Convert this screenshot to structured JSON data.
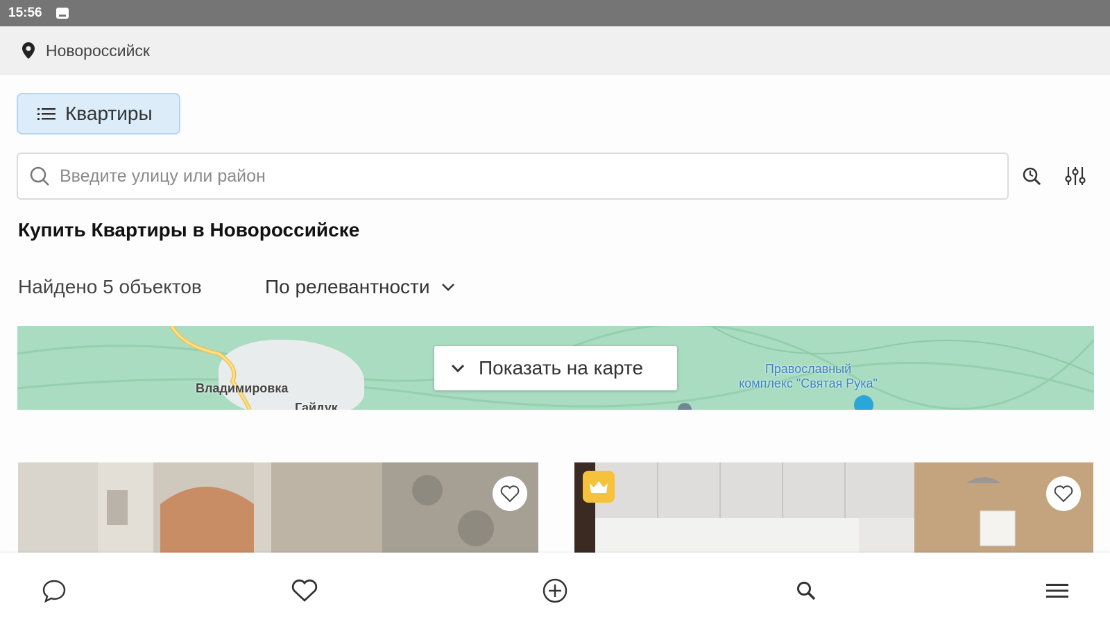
{
  "status_bar": {
    "time": "15:56"
  },
  "location": {
    "city": "Новороссийск"
  },
  "category_chip": {
    "label": "Квартиры"
  },
  "search": {
    "placeholder": "Введите улицу или район"
  },
  "page_heading": "Купить Квартиры в Новороссийске",
  "results": {
    "found_text": "Найдено 5 объектов",
    "sort_label": "По релевантности"
  },
  "map": {
    "button_label": "Показать на карте",
    "labels": {
      "village": "Владимировка",
      "village2": "Гайдук",
      "poi_line1": "Православный",
      "poi_line2": "комплекс \"Святая Рука\""
    }
  },
  "listings": [
    {
      "premium": false,
      "favorite": false
    },
    {
      "premium": true,
      "favorite": false
    }
  ],
  "bottom_nav": [
    "chat-icon",
    "favorites-icon",
    "add-icon",
    "search-icon",
    "menu-icon"
  ],
  "colors": {
    "chip_bg": "#dcecf9",
    "premium": "#f6c23b",
    "map": "#a9dcc0"
  }
}
